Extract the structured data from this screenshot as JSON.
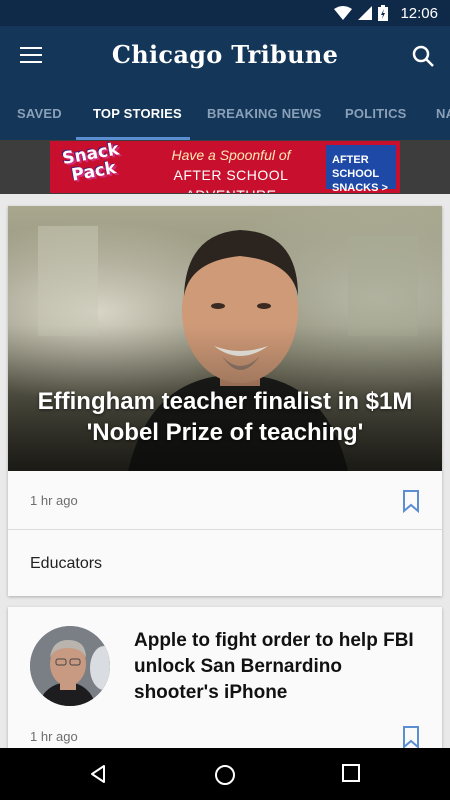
{
  "status_bar": {
    "time": "12:06"
  },
  "app_bar": {
    "title": "Chicago Tribune"
  },
  "tabs": [
    {
      "label": "SAVED",
      "active": false
    },
    {
      "label": "TOP STORIES",
      "active": true
    },
    {
      "label": "BREAKING NEWS",
      "active": false
    },
    {
      "label": "POLITICS",
      "active": false
    },
    {
      "label": "NA",
      "active": false
    }
  ],
  "ad": {
    "brand": "Snack Pack",
    "tagline_line1": "Have a Spoonful of",
    "tagline_line2": "AFTER SCHOOL ADVENTURE",
    "cta": "AFTER SCHOOL SNACKS >"
  },
  "stories": [
    {
      "headline": "Effingham teacher finalist in $1M 'Nobel Prize of teaching'",
      "time": "1 hr ago",
      "topic": "Educators"
    },
    {
      "headline": "Apple to fight order to help FBI unlock San Bernardino shooter's iPhone",
      "time": "1 hr ago"
    }
  ],
  "colors": {
    "status_bar": "#0f2a48",
    "app_bar": "#143658",
    "tab_active": "#ffffff",
    "tab_inactive": "#8aa0b8",
    "indicator": "#5b8fd1",
    "bookmark": "#5b8fd1"
  }
}
